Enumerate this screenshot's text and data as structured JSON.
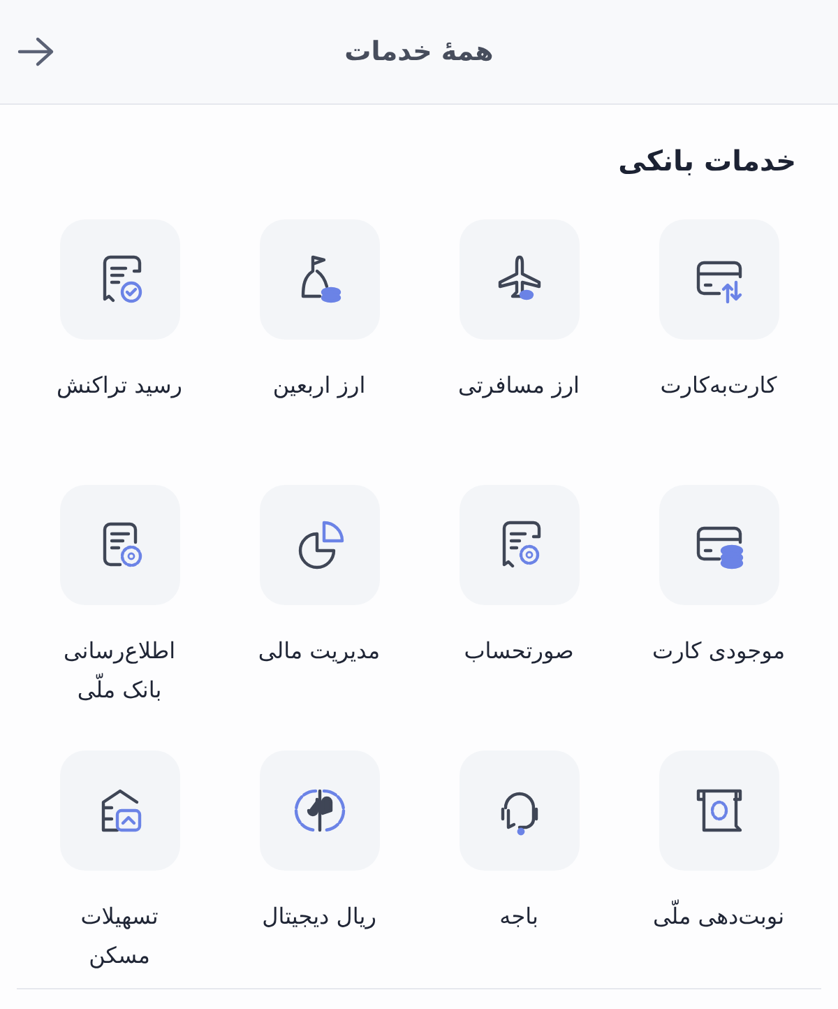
{
  "header": {
    "title": "همهٔ خدمات"
  },
  "section": {
    "title": "خدمات بانکی",
    "items": [
      {
        "kind": "card-transfer",
        "label": "کارت‌به‌کارت"
      },
      {
        "kind": "plane",
        "label": "ارز مسافرتی"
      },
      {
        "kind": "bag",
        "label": "ارز اربعین"
      },
      {
        "kind": "receipt-check",
        "label": "رسید تراکنش"
      },
      {
        "kind": "card-coins",
        "label": "موجودی کارت"
      },
      {
        "kind": "receipt-seal",
        "label": "صورتحساب"
      },
      {
        "kind": "pie",
        "label": "مدیریت مالی"
      },
      {
        "kind": "doc-seal",
        "label": "اطلاع‌رسانی\nبانک ملّی"
      },
      {
        "kind": "scroll",
        "label": "نوبت‌دهی ملّی"
      },
      {
        "kind": "headset",
        "label": "باجه"
      },
      {
        "kind": "digital-rial",
        "label": "ریال دیجیتال"
      },
      {
        "kind": "house",
        "label": "تسهیلات\nمسکن"
      }
    ]
  }
}
